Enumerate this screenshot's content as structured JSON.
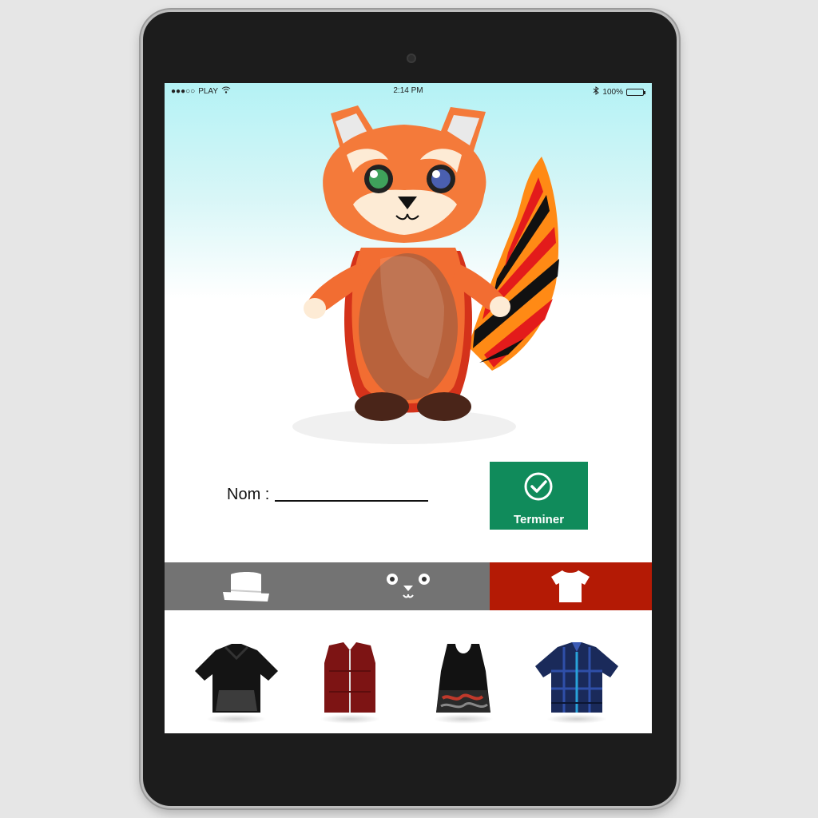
{
  "status_bar": {
    "carrier": "PLAY",
    "time": "2:14 PM",
    "battery": "100%"
  },
  "form": {
    "name_label": "Nom :",
    "finish_label": "Terminer"
  },
  "tabs": [
    {
      "name": "hat-icon",
      "active": false
    },
    {
      "name": "face-icon",
      "active": false
    },
    {
      "name": "shirt-icon",
      "active": true
    }
  ],
  "clothing_items": [
    {
      "name": "black-hoodie-icon"
    },
    {
      "name": "red-vest-icon"
    },
    {
      "name": "black-tank-dress-icon"
    },
    {
      "name": "plaid-shirt-icon"
    }
  ],
  "colors": {
    "finish_button": "#108b5b",
    "active_tab": "#b41a05",
    "tab_bar": "#737373"
  }
}
